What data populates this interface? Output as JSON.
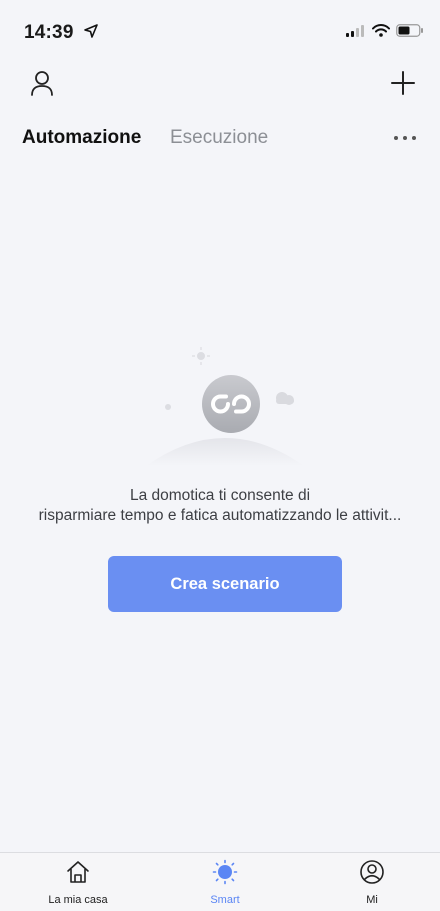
{
  "status_bar": {
    "time": "14:39"
  },
  "header": {
    "tabs": [
      {
        "label": "Automazione",
        "active": true
      },
      {
        "label": "Esecuzione",
        "active": false
      }
    ]
  },
  "empty_state": {
    "line1": "La domotica ti consente di",
    "line2": "risparmiare tempo e fatica automatizzando le attivit..."
  },
  "cta": {
    "label": "Crea scenario"
  },
  "bottom_nav": {
    "items": [
      {
        "label": "La mia casa",
        "icon": "home-icon",
        "active": false
      },
      {
        "label": "Smart",
        "icon": "sun-icon",
        "active": true
      },
      {
        "label": "Mi",
        "icon": "profile-icon",
        "active": false
      }
    ]
  },
  "colors": {
    "accent": "#6a8ff2",
    "active_nav": "#5b86f4",
    "background": "#f4f5f9"
  }
}
